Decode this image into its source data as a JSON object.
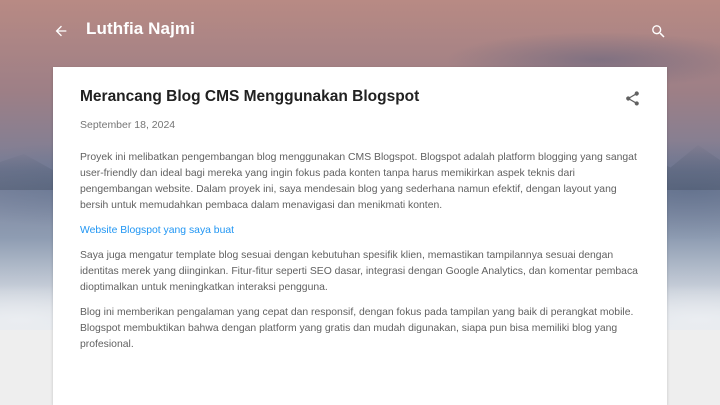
{
  "header": {
    "site_title": "Luthfia Najmi",
    "back_icon": "arrow-back-icon",
    "search_icon": "search-icon"
  },
  "post": {
    "title": "Merancang Blog CMS Menggunakan Blogspot",
    "date": "September 18, 2024",
    "share_icon": "share-icon",
    "paragraphs": [
      "Proyek ini melibatkan pengembangan blog menggunakan CMS Blogspot. Blogspot adalah platform blogging yang sangat user-friendly dan ideal bagi mereka yang ingin fokus pada konten tanpa harus memikirkan aspek teknis dari pengembangan website. Dalam proyek ini, saya mendesain blog yang sederhana namun efektif, dengan layout yang bersih untuk memudahkan pembaca dalam menavigasi dan menikmati konten.",
      "Saya juga mengatur template blog sesuai dengan kebutuhan spesifik klien, memastikan tampilannya sesuai dengan identitas merek yang diinginkan. Fitur-fitur seperti SEO dasar, integrasi dengan Google Analytics, dan komentar pembaca dioptimalkan untuk meningkatkan interaksi pengguna.",
      "Blog ini memberikan pengalaman yang cepat dan responsif, dengan fokus pada tampilan yang baik di perangkat mobile. Blogspot membuktikan bahwa dengan platform yang gratis dan mudah digunakan, siapa pun bisa memiliki blog yang profesional."
    ],
    "link_text": "Website Blogspot yang saya buat"
  },
  "colors": {
    "link": "#2196f3",
    "card": "#ffffff",
    "page_background": "#eeeeee"
  }
}
